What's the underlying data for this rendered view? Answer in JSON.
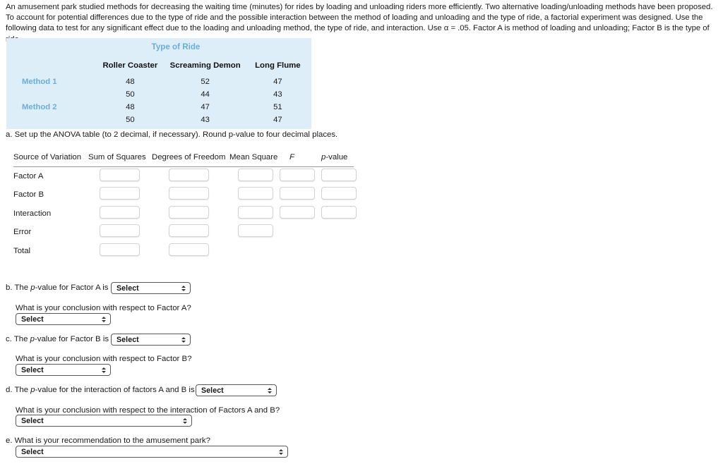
{
  "intro": "An amusement park studied methods for decreasing the waiting time (minutes) for rides by loading and unloading riders more efficiently. Two alternative loading/unloading methods have been proposed. To account for potential differences due to the type of ride and the possible interaction between the method of loading and unloading and the type of ride, a factorial experiment was designed. Use the following data to test for any significant effect due to the loading and unloading method, the type of ride, and interaction. Use α = .05. Factor A is method of loading and unloading; Factor B is the type of ride.",
  "data_table": {
    "title": "Type of Ride",
    "background_color": "#ddeef8",
    "accent_color": "#6aaedd",
    "columns": [
      "Roller Coaster",
      "Screaming Demon",
      "Long Flume"
    ],
    "rows": [
      {
        "label": "Method 1",
        "values": [
          "48",
          "52",
          "47"
        ]
      },
      {
        "label": "",
        "values": [
          "50",
          "44",
          "43"
        ]
      },
      {
        "label": "Method 2",
        "values": [
          "48",
          "47",
          "51"
        ]
      },
      {
        "label": "",
        "values": [
          "50",
          "43",
          "47"
        ]
      }
    ]
  },
  "part_a": {
    "heading": "a. Set up the ANOVA table (to 2 decimal, if necessary). Round p-value to four decimal places.",
    "columns": {
      "source": "Source of Variation",
      "ss": "Sum of Squares",
      "df": "Degrees of Freedom",
      "ms": "Mean Square",
      "f": "F",
      "p": "p-value"
    },
    "rows": [
      {
        "label": "Factor A",
        "ss": "",
        "df": "",
        "ms": "",
        "f": "",
        "p": ""
      },
      {
        "label": "Factor B",
        "ss": "",
        "df": "",
        "ms": "",
        "f": "",
        "p": ""
      },
      {
        "label": "Interaction",
        "ss": "",
        "df": "",
        "ms": "",
        "f": "",
        "p": ""
      },
      {
        "label": "Error",
        "ss": "",
        "df": "",
        "ms": ""
      },
      {
        "label": "Total",
        "ss": "",
        "df": ""
      }
    ]
  },
  "part_b": {
    "prompt_pre": "b. The ",
    "prompt_italic": "p",
    "prompt_post": "-value for Factor A is",
    "pvalue_select": "Select",
    "conclusion_question": "What is your conclusion with respect to Factor A?",
    "conclusion_select": "Select"
  },
  "part_c": {
    "prompt_pre": "c. The ",
    "prompt_italic": "p",
    "prompt_post": "-value for Factor B is",
    "pvalue_select": "Select",
    "conclusion_question": "What is your conclusion with respect to Factor B?",
    "conclusion_select": "Select"
  },
  "part_d": {
    "prompt_pre": "d. The ",
    "prompt_italic": "p",
    "prompt_post": "-value for the interaction of factors A and B is",
    "pvalue_select": "Select",
    "conclusion_question": "What is your conclusion with respect to the interaction of Factors A and B?",
    "conclusion_select": "Select"
  },
  "part_e": {
    "question": "e. What is your recommendation to the amusement park?",
    "select": "Select"
  }
}
